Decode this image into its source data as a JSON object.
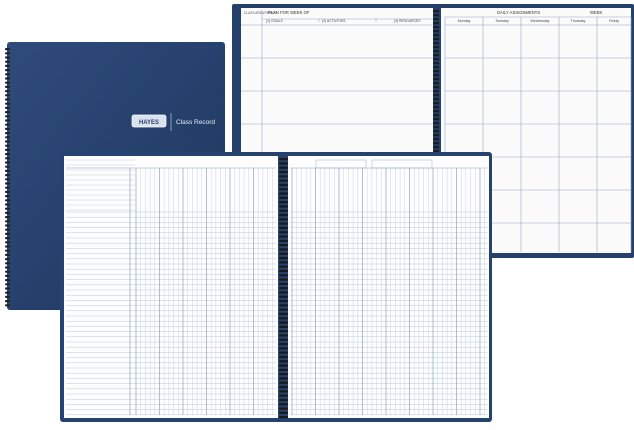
{
  "cover": {
    "logo_text": "HAYES",
    "title": "Class Record"
  },
  "lesson_plan": {
    "left_header": "PLAN FOR WEEK OF",
    "left_subheaders": [
      "(1) GOALS",
      "(2) ACTIVITIES",
      "(3) RESOURCES"
    ],
    "side_label": "CLASS AREA PERIOD",
    "right_header": "DAILY ASSIGNMENTS",
    "week_label": "WEEK",
    "days": [
      "Monday",
      "Tuesday",
      "Wednesday",
      "Thursday",
      "Friday"
    ]
  },
  "colors": {
    "cover_blue": "#27426e",
    "page_white": "#ffffff",
    "grid_blue": "#9ab0cf",
    "spiral_black": "#1d1d1d"
  }
}
